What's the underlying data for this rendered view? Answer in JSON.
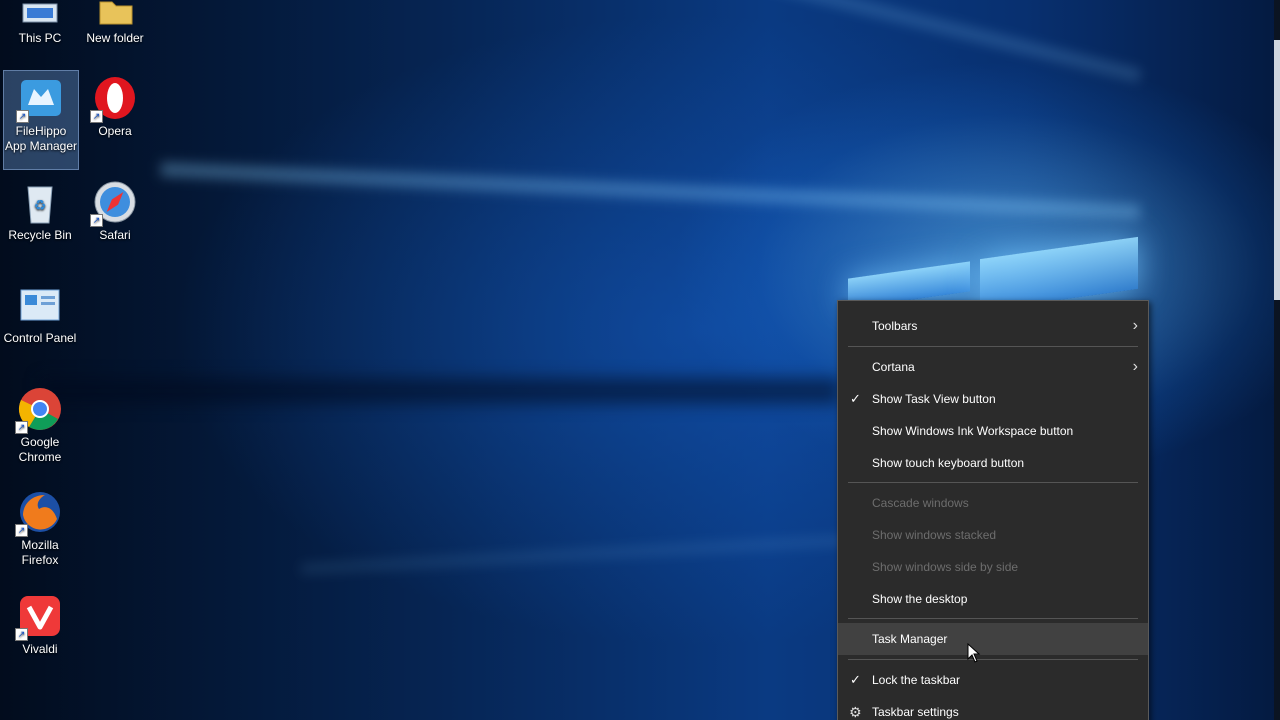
{
  "desktop_icons": [
    {
      "label": "This PC",
      "icon": "this-pc-icon"
    },
    {
      "label": "New folder",
      "icon": "folder-icon"
    },
    {
      "label": "FileHippo App Manager",
      "icon": "filehippo-icon"
    },
    {
      "label": "Opera",
      "icon": "opera-icon"
    },
    {
      "label": "Recycle Bin",
      "icon": "recycle-bin-icon"
    },
    {
      "label": "Safari",
      "icon": "safari-icon"
    },
    {
      "label": "Control Panel",
      "icon": "control-panel-icon"
    },
    {
      "label": "Google Chrome",
      "icon": "chrome-icon"
    },
    {
      "label": "Mozilla Firefox",
      "icon": "firefox-icon"
    },
    {
      "label": "Vivaldi",
      "icon": "vivaldi-icon"
    }
  ],
  "context_menu": {
    "items": [
      {
        "label": "Toolbars",
        "state": "submenu"
      },
      {
        "label": "Cortana",
        "state": "submenu"
      },
      {
        "label": "Show Task View button",
        "state": "checked"
      },
      {
        "label": "Show Windows Ink Workspace button",
        "state": "enabled"
      },
      {
        "label": "Show touch keyboard button",
        "state": "enabled"
      },
      {
        "label": "Cascade windows",
        "state": "disabled"
      },
      {
        "label": "Show windows stacked",
        "state": "disabled"
      },
      {
        "label": "Show windows side by side",
        "state": "disabled"
      },
      {
        "label": "Show the desktop",
        "state": "enabled"
      },
      {
        "label": "Task Manager",
        "state": "hovered"
      },
      {
        "label": "Lock the taskbar",
        "state": "checked"
      },
      {
        "label": "Taskbar settings",
        "state": "settings"
      }
    ]
  },
  "colors": {
    "menu_background": "#2b2b2b",
    "menu_hover": "#414141",
    "disabled_text": "#6d6d6d",
    "wallpaper_blue": "#0a3a82"
  }
}
